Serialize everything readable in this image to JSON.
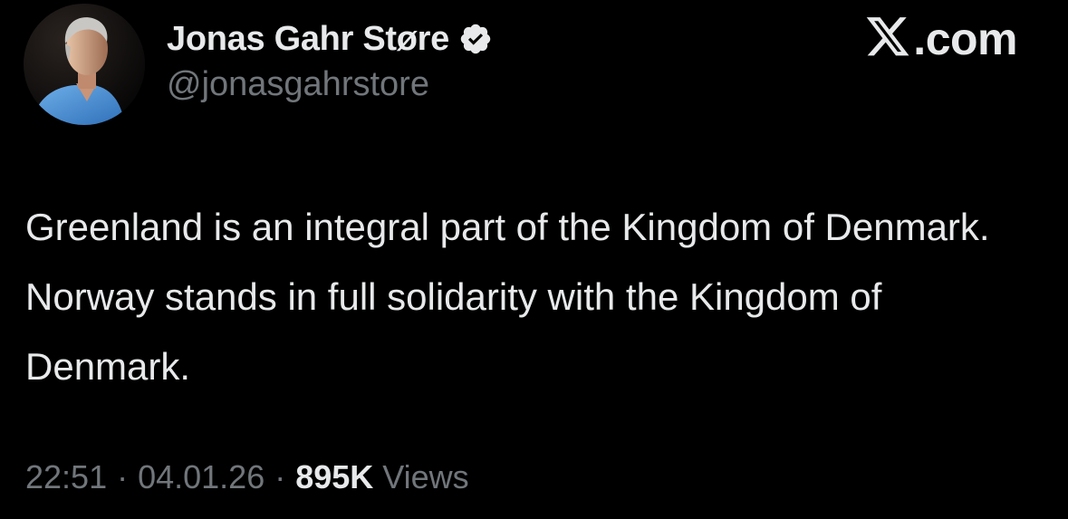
{
  "author": {
    "name": "Jonas Gahr Støre",
    "handle": "@jonasgahrstore",
    "verified": true,
    "avatar_icon": "profile-photo",
    "verified_icon": "verified-badge-icon"
  },
  "brand": {
    "label": ".com",
    "icon": "x-logo-icon"
  },
  "tweet": {
    "text": "Greenland is an integral part of the Kingdom of Denmark. Norway stands in full solidarity with the Kingdom of Denmark."
  },
  "meta": {
    "time": "22:51",
    "separator": "·",
    "date": "04.01.26",
    "views_count": "895K",
    "views_label": "Views"
  },
  "colors": {
    "background": "#000000",
    "text_primary": "#e7e9ea",
    "text_secondary": "#71767b",
    "verified_badge": "#e7e9ea"
  }
}
